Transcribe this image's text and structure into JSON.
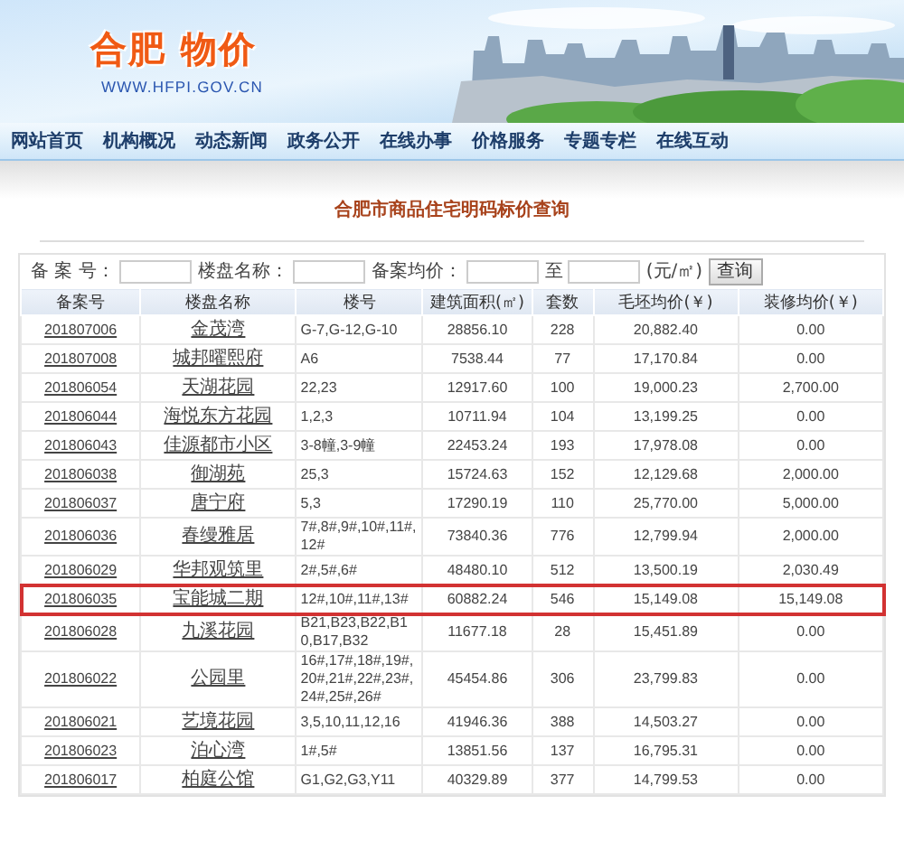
{
  "header": {
    "logo": "合肥 物价",
    "url": "WWW.HFPI.GOV.CN"
  },
  "nav": [
    "网站首页",
    "机构概况",
    "动态新闻",
    "政务公开",
    "在线办事",
    "价格服务",
    "专题专栏",
    "在线互动"
  ],
  "page_title": "合肥市商品住宅明码标价查询",
  "search": {
    "fields": [
      {
        "label": "备 案 号："
      },
      {
        "label": "楼盘名称："
      },
      {
        "label": "备案均价："
      },
      {
        "label": "至"
      }
    ],
    "unit": "(元/㎡)",
    "button": "查询"
  },
  "table": {
    "columns": [
      "备案号",
      "楼盘名称",
      "楼号",
      "建筑面积(㎡)",
      "套数",
      "毛坯均价(￥)",
      "装修均价(￥)"
    ],
    "rows": [
      {
        "id": "201807006",
        "name": "金茂湾",
        "buildings": "G-7,G-12,G-10",
        "area": "28856.10",
        "units": "228",
        "raw_price": "20,882.40",
        "finished_price": "0.00",
        "highlighted": false
      },
      {
        "id": "201807008",
        "name": "城邦曜熙府",
        "buildings": "A6",
        "area": "7538.44",
        "units": "77",
        "raw_price": "17,170.84",
        "finished_price": "0.00",
        "highlighted": false
      },
      {
        "id": "201806054",
        "name": "天湖花园",
        "buildings": "22,23",
        "area": "12917.60",
        "units": "100",
        "raw_price": "19,000.23",
        "finished_price": "2,700.00",
        "highlighted": false
      },
      {
        "id": "201806044",
        "name": "海悦东方花园",
        "buildings": "1,2,3",
        "area": "10711.94",
        "units": "104",
        "raw_price": "13,199.25",
        "finished_price": "0.00",
        "highlighted": false
      },
      {
        "id": "201806043",
        "name": "佳源都市小区",
        "buildings": "3-8幢,3-9幢",
        "area": "22453.24",
        "units": "193",
        "raw_price": "17,978.08",
        "finished_price": "0.00",
        "highlighted": false
      },
      {
        "id": "201806038",
        "name": "御湖苑",
        "buildings": "25,3",
        "area": "15724.63",
        "units": "152",
        "raw_price": "12,129.68",
        "finished_price": "2,000.00",
        "highlighted": false
      },
      {
        "id": "201806037",
        "name": "唐宁府",
        "buildings": "5,3",
        "area": "17290.19",
        "units": "110",
        "raw_price": "25,770.00",
        "finished_price": "5,000.00",
        "highlighted": false
      },
      {
        "id": "201806036",
        "name": "春缦雅居",
        "buildings": "7#,8#,9#,10#,11#,12#",
        "area": "73840.36",
        "units": "776",
        "raw_price": "12,799.94",
        "finished_price": "2,000.00",
        "highlighted": false
      },
      {
        "id": "201806029",
        "name": "华邦观筑里",
        "buildings": "2#,5#,6#",
        "area": "48480.10",
        "units": "512",
        "raw_price": "13,500.19",
        "finished_price": "2,030.49",
        "highlighted": false
      },
      {
        "id": "201806035",
        "name": "宝能城二期",
        "buildings": "12#,10#,11#,13#",
        "area": "60882.24",
        "units": "546",
        "raw_price": "15,149.08",
        "finished_price": "15,149.08",
        "highlighted": true
      },
      {
        "id": "201806028",
        "name": "九溪花园",
        "buildings": "B21,B23,B22,B10,B17,B32",
        "area": "11677.18",
        "units": "28",
        "raw_price": "15,451.89",
        "finished_price": "0.00",
        "highlighted": false
      },
      {
        "id": "201806022",
        "name": "公园里",
        "buildings": "16#,17#,18#,19#,20#,21#,22#,23#,24#,25#,26#",
        "area": "45454.86",
        "units": "306",
        "raw_price": "23,799.83",
        "finished_price": "0.00",
        "highlighted": false
      },
      {
        "id": "201806021",
        "name": "艺境花园",
        "buildings": "3,5,10,11,12,16",
        "area": "41946.36",
        "units": "388",
        "raw_price": "14,503.27",
        "finished_price": "0.00",
        "highlighted": false
      },
      {
        "id": "201806023",
        "name": "泊心湾",
        "buildings": "1#,5#",
        "area": "13851.56",
        "units": "137",
        "raw_price": "16,795.31",
        "finished_price": "0.00",
        "highlighted": false
      },
      {
        "id": "201806017",
        "name": "柏庭公馆",
        "buildings": "G1,G2,G3,Y11",
        "area": "40329.89",
        "units": "377",
        "raw_price": "14,799.53",
        "finished_price": "0.00",
        "highlighted": false
      }
    ]
  }
}
